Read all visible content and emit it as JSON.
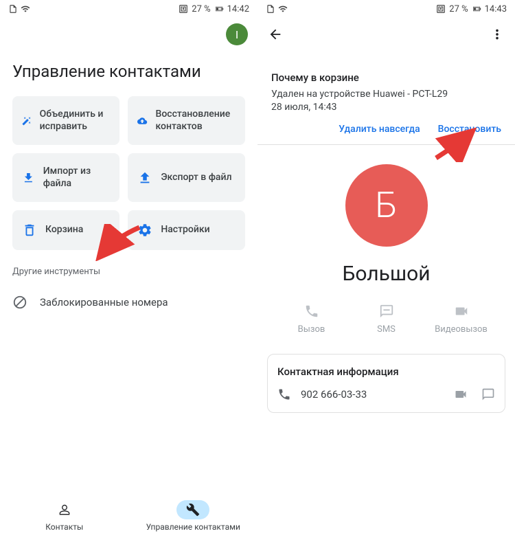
{
  "left": {
    "status": {
      "battery_text": "27 %",
      "time": "14:42"
    },
    "avatar_initial": "I",
    "title": "Управление контактами",
    "tiles": [
      {
        "label": "Объединить и исправить"
      },
      {
        "label": "Восстановление контактов"
      },
      {
        "label": "Импорт из файла"
      },
      {
        "label": "Экспорт в файл"
      },
      {
        "label": "Корзина"
      },
      {
        "label": "Настройки"
      }
    ],
    "other_tools_label": "Другие инструменты",
    "blocked_label": "Заблокированные номера",
    "nav": {
      "contacts": "Контакты",
      "manage": "Управление контактами"
    }
  },
  "right": {
    "status": {
      "battery_text": "27 %",
      "time": "14:43"
    },
    "trash": {
      "title": "Почему в корзине",
      "sub1": "Удален на устройстве Huawei - PCT-L29",
      "sub2": "28 июля, 14:43",
      "delete": "Удалить навсегда",
      "restore": "Восстановить"
    },
    "contact": {
      "initial": "Б",
      "name": "Большой"
    },
    "actions": {
      "call": "Вызов",
      "sms": "SMS",
      "video": "Видеовызов"
    },
    "info": {
      "title": "Контактная информация",
      "phone": "902 666-03-33"
    }
  }
}
